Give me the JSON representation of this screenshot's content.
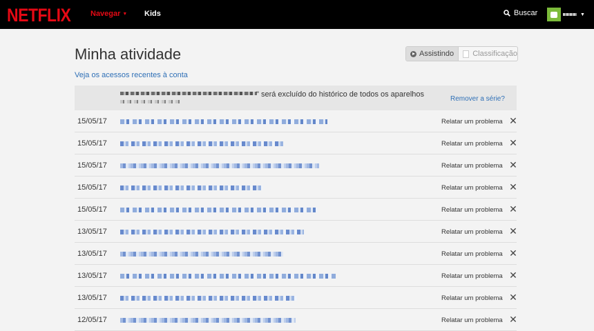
{
  "nav": {
    "logo": "NETFLIX",
    "browse": "Navegar",
    "kids": "Kids",
    "search": "Buscar"
  },
  "page": {
    "title": "Minha atividade",
    "recent_access_link": "Veja os acessos recentes à conta"
  },
  "toggle": {
    "watching": "Assistindo",
    "ratings": "Classificação"
  },
  "notice": {
    "text": "\" será excluído do histórico de todos os aparelhos",
    "action": "Remover a série?"
  },
  "rows": [
    {
      "date": "15/05/17",
      "action": "Relatar um problema"
    },
    {
      "date": "15/05/17",
      "action": "Relatar um problema"
    },
    {
      "date": "15/05/17",
      "action": "Relatar um problema"
    },
    {
      "date": "15/05/17",
      "action": "Relatar um problema"
    },
    {
      "date": "15/05/17",
      "action": "Relatar um problema"
    },
    {
      "date": "13/05/17",
      "action": "Relatar um problema"
    },
    {
      "date": "13/05/17",
      "action": "Relatar um problema"
    },
    {
      "date": "13/05/17",
      "action": "Relatar um problema"
    },
    {
      "date": "13/05/17",
      "action": "Relatar um problema"
    },
    {
      "date": "12/05/17",
      "action": "Relatar um problema"
    }
  ],
  "icons": {
    "search": "search-icon",
    "remove": "close-icon",
    "dropdown": "caret-down-icon"
  },
  "colors": {
    "brand": "#e50914",
    "link": "#2e6fb6",
    "nav_bg": "#000000"
  }
}
